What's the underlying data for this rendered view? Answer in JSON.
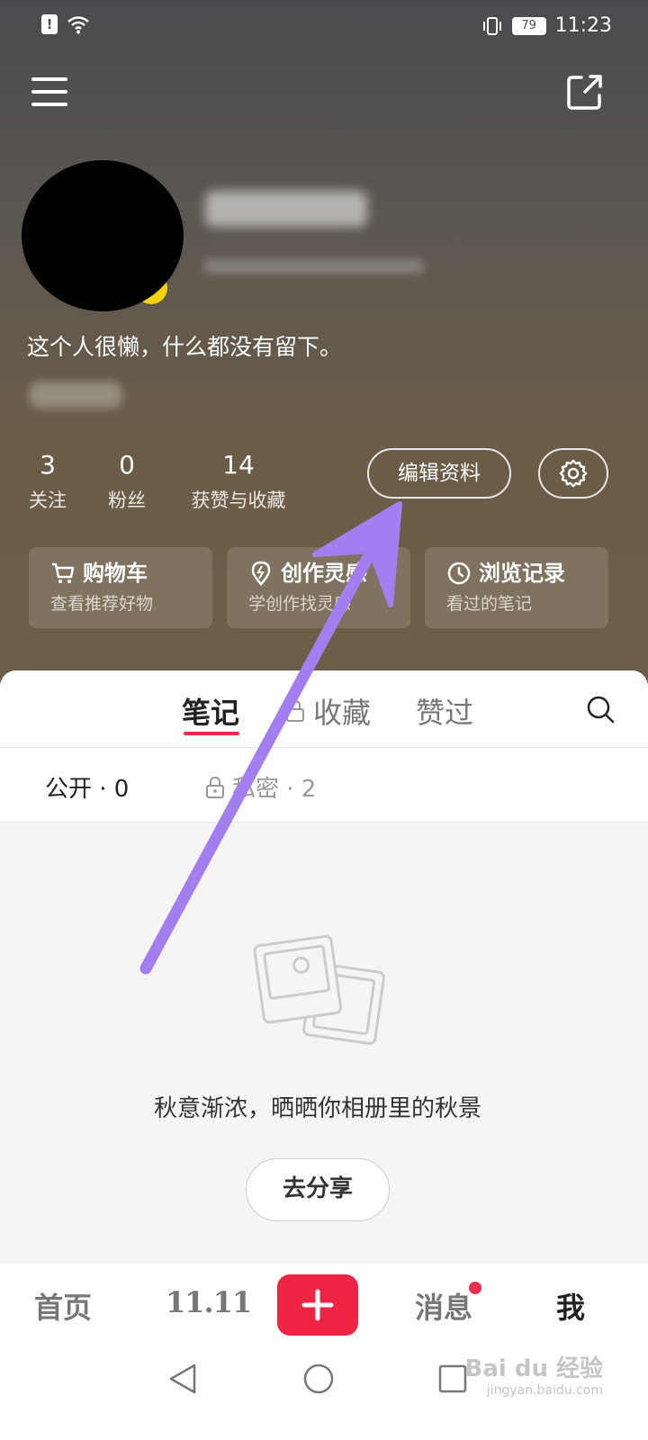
{
  "status_bar": {
    "time": "11:23",
    "battery": "79"
  },
  "profile": {
    "bio": "这个人很懒，什么都没有留下。",
    "stats": [
      {
        "value": "3",
        "label": "关注"
      },
      {
        "value": "0",
        "label": "粉丝"
      },
      {
        "value": "14",
        "label": "获赞与收藏"
      }
    ],
    "edit_label": "编辑资料"
  },
  "cards": [
    {
      "icon": "cart-icon",
      "title": "购物车",
      "subtitle": "查看推荐好物"
    },
    {
      "icon": "bulb-icon",
      "title": "创作灵感",
      "subtitle": "学创作找灵感"
    },
    {
      "icon": "clock-icon",
      "title": "浏览记录",
      "subtitle": "看过的笔记"
    }
  ],
  "tabs": [
    {
      "label": "笔记",
      "active": true
    },
    {
      "label": "收藏",
      "active": false
    },
    {
      "label": "赞过",
      "active": false
    }
  ],
  "subtabs": {
    "public": "公开 · 0",
    "private": "私密 · 2"
  },
  "empty": {
    "message": "秋意渐浓，晒晒你相册里的秋景",
    "button": "去分享"
  },
  "bottom_nav": {
    "home": "首页",
    "promo": "11.11",
    "messages": "消息",
    "me": "我"
  },
  "watermark": {
    "main": "Bai du 经验",
    "sub": "jingyan.baidu.com"
  },
  "colors": {
    "accent": "#ee2444",
    "annotation": "#a37ef0"
  }
}
